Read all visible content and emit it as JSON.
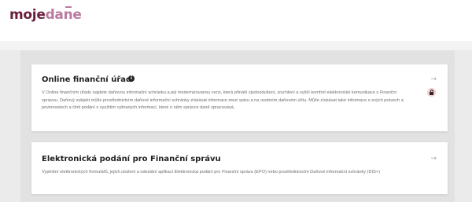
{
  "header": {
    "logo_part1": "moje",
    "logo_part2": "dane"
  },
  "cards": [
    {
      "title": "Online finanční úřad",
      "info_icon": "info-icon",
      "description": "V Online finančním úřadu najdete daňovou informační schránku a její modernizovanou verzi, která přináší zjednodušení, zrychlení a vyšší komfort elektronické komunikace s Finanční správou. Daňový subjekt může prostřednictvím daňové informační schránky získávat informace mezi spisu a na osobním daňovém účtu. Může získávat také informace o svých právech a povinnostech a činit podání s využitím vybraných informací, které o něm správce daně zpracovává.",
      "arrow_icon": "arrow-right-icon",
      "status_icon": "lock-icon"
    },
    {
      "title": "Elektronická podání pro Finanční správu",
      "description": "Vyplnění elektronických formulářů, jejich uložení a odeslání aplikací Elektronická podání pro Finanční správu (EPO) nebo prostřednictvím Daňové informační schránky (DIS+)",
      "arrow_icon": "arrow-right-icon"
    }
  ],
  "colors": {
    "brand_dark": "#6b1e3c",
    "brand_light": "#b97aa0",
    "lock_badge": "#f4cdd3"
  }
}
